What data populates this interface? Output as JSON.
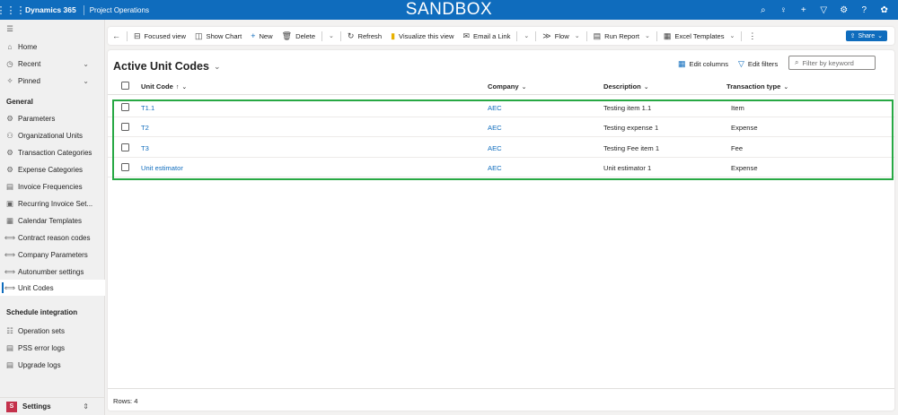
{
  "topbar": {
    "app_name": "Dynamics 365",
    "area_name": "Project Operations",
    "environment": "SANDBOX",
    "icons": [
      "search-icon",
      "lightbulb-icon",
      "plus-icon",
      "filter-icon",
      "gear-icon",
      "help-icon",
      "copilot-icon"
    ]
  },
  "sidebar": {
    "top_items": [
      {
        "label": "Home",
        "icon": "home-icon"
      },
      {
        "label": "Recent",
        "icon": "clock-icon"
      },
      {
        "label": "Pinned",
        "icon": "pin-icon"
      }
    ],
    "general_heading": "General",
    "general_items": [
      {
        "label": "Parameters"
      },
      {
        "label": "Organizational Units"
      },
      {
        "label": "Transaction Categories"
      },
      {
        "label": "Expense Categories"
      },
      {
        "label": "Invoice Frequencies"
      },
      {
        "label": "Recurring Invoice Set..."
      },
      {
        "label": "Calendar Templates"
      },
      {
        "label": "Contract reason codes"
      },
      {
        "label": "Company Parameters"
      },
      {
        "label": "Autonumber settings"
      },
      {
        "label": "Unit Codes"
      }
    ],
    "schedule_heading": "Schedule integration",
    "schedule_items": [
      {
        "label": "Operation sets"
      },
      {
        "label": "PSS error logs"
      },
      {
        "label": "Upgrade logs"
      }
    ],
    "area_switcher": {
      "badge": "S",
      "label": "Settings"
    }
  },
  "commandbar": {
    "focused_view": "Focused view",
    "show_chart": "Show Chart",
    "new": "New",
    "delete": "Delete",
    "refresh": "Refresh",
    "visualize": "Visualize this view",
    "email_link": "Email a Link",
    "flow": "Flow",
    "run_report": "Run Report",
    "excel_templates": "Excel Templates",
    "share": "Share"
  },
  "view": {
    "title": "Active Unit Codes",
    "edit_columns": "Edit columns",
    "edit_filters": "Edit filters",
    "filter_placeholder": "Filter by keyword"
  },
  "grid": {
    "columns": {
      "unit_code": "Unit Code",
      "company": "Company",
      "description": "Description",
      "transaction_type": "Transaction type"
    },
    "sort_indicator": "↑",
    "rows": [
      {
        "unit_code": "T1.1",
        "company": "AEC",
        "description": "Testing item 1.1",
        "transaction_type": "Item"
      },
      {
        "unit_code": "T2",
        "company": "AEC",
        "description": "Testing expense 1",
        "transaction_type": "Expense"
      },
      {
        "unit_code": "T3",
        "company": "AEC",
        "description": "Testing Fee item 1",
        "transaction_type": "Fee"
      },
      {
        "unit_code": "Unit estimator",
        "company": "AEC",
        "description": "Unit estimator 1",
        "transaction_type": "Expense"
      }
    ],
    "row_count": "Rows: 4"
  },
  "colors": {
    "brand": "#0f6cbd",
    "highlight": "#27a844",
    "settings_badge": "#c4314b"
  }
}
